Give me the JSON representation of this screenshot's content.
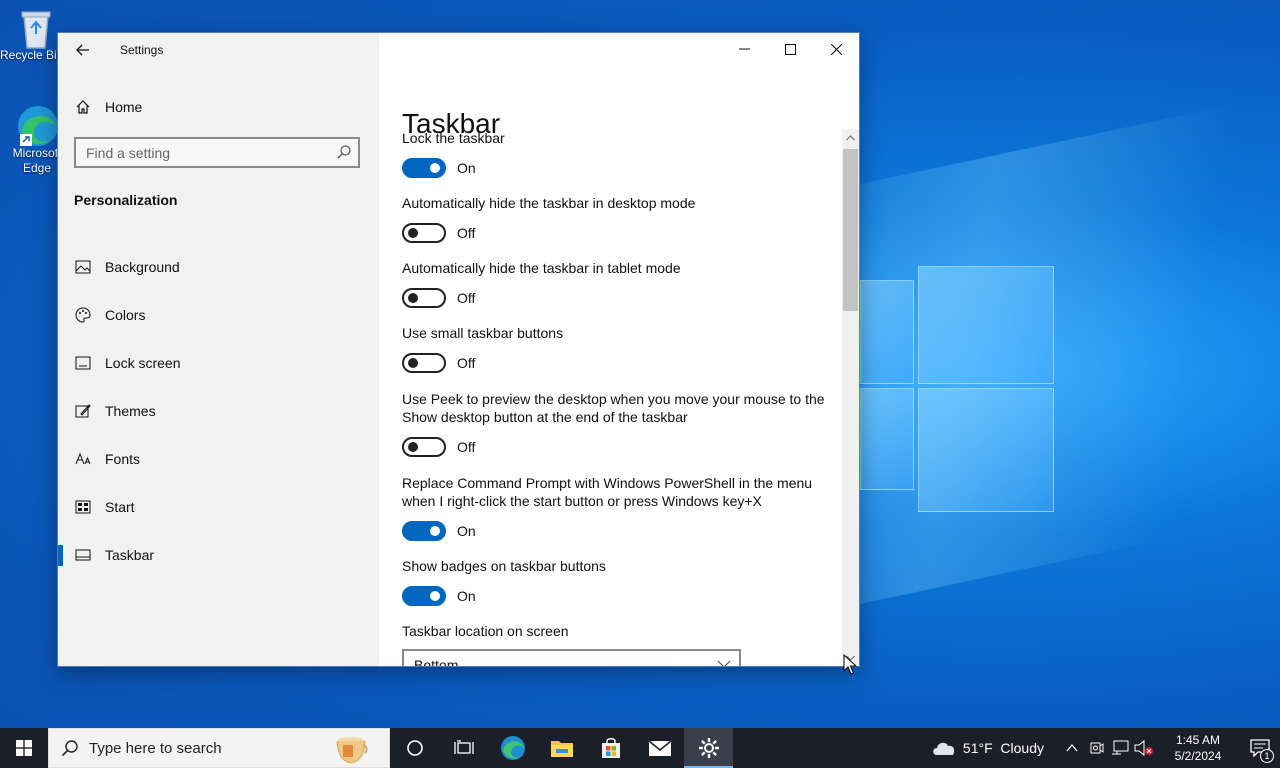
{
  "desktop": {
    "icons": [
      {
        "label": "Recycle Bin"
      },
      {
        "label": "Microsoft Edge"
      }
    ]
  },
  "window": {
    "app_title": "Settings",
    "sidebar": {
      "home_label": "Home",
      "search_placeholder": "Find a setting",
      "section": "Personalization",
      "items": [
        {
          "label": "Background",
          "icon": "image-icon"
        },
        {
          "label": "Colors",
          "icon": "palette-icon"
        },
        {
          "label": "Lock screen",
          "icon": "lock-screen-icon"
        },
        {
          "label": "Themes",
          "icon": "themes-icon"
        },
        {
          "label": "Fonts",
          "icon": "fonts-icon"
        },
        {
          "label": "Start",
          "icon": "start-icon"
        },
        {
          "label": "Taskbar",
          "icon": "taskbar-icon",
          "active": true
        }
      ]
    },
    "page_title": "Taskbar",
    "settings": [
      {
        "label": "Lock the taskbar",
        "state": "On"
      },
      {
        "label": "Automatically hide the taskbar in desktop mode",
        "state": "Off"
      },
      {
        "label": "Automatically hide the taskbar in tablet mode",
        "state": "Off"
      },
      {
        "label": "Use small taskbar buttons",
        "state": "Off"
      },
      {
        "label": "Use Peek to preview the desktop when you move your mouse to the Show desktop button at the end of the taskbar",
        "state": "Off"
      },
      {
        "label": "Replace Command Prompt with Windows PowerShell in the menu when I right-click the start button or press Windows key+X",
        "state": "On"
      },
      {
        "label": "Show badges on taskbar buttons",
        "state": "On"
      }
    ],
    "location": {
      "label": "Taskbar location on screen",
      "value": "Bottom"
    }
  },
  "taskbar": {
    "search_placeholder": "Type here to search",
    "weather": "51°F  Cloudy",
    "time": "1:45 AM",
    "date": "5/2/2024",
    "notification_count": "1"
  },
  "colors": {
    "accent": "#0067c0",
    "taskbar": "#1b1f2a"
  }
}
